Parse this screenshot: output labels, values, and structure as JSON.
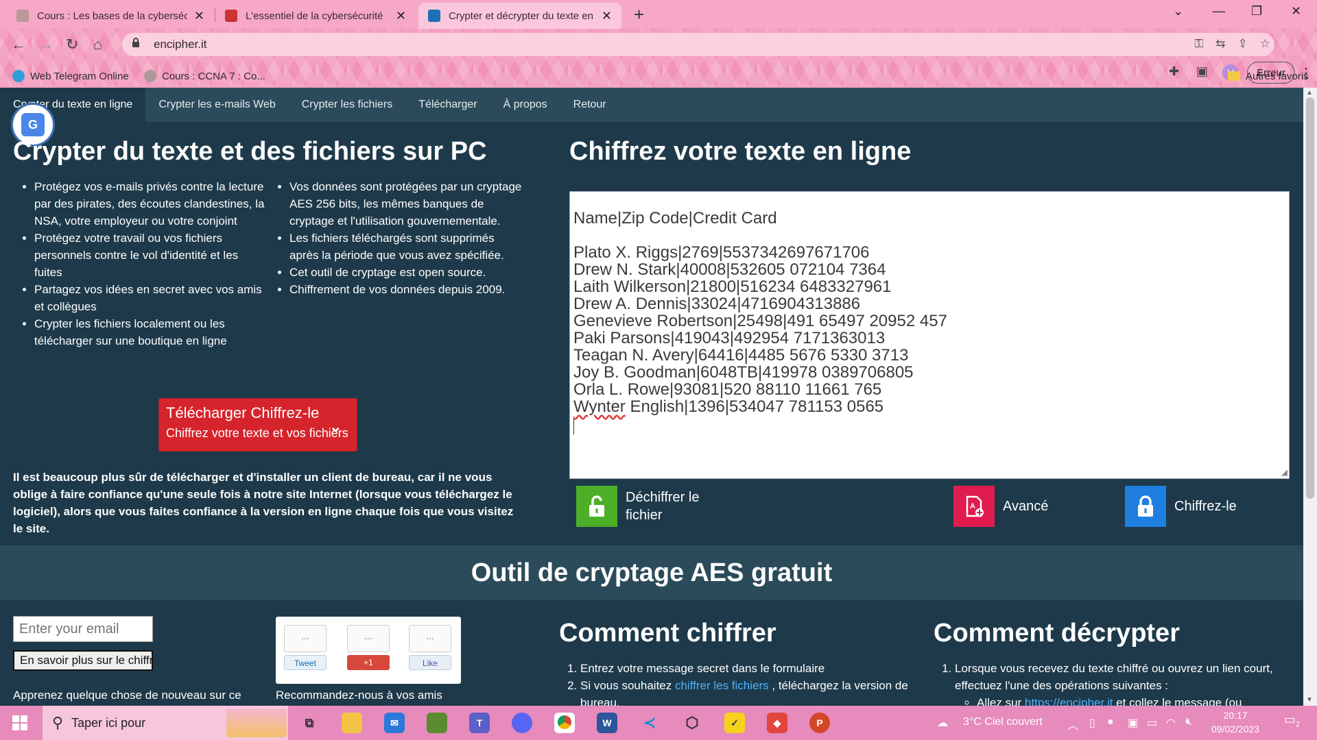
{
  "browser": {
    "tabs": [
      {
        "title": "Cours : Les bases de la cybersécu",
        "active": false
      },
      {
        "title": "L'essentiel de la cybersécurité",
        "active": false
      },
      {
        "title": "Crypter et décrypter du texte en",
        "active": true
      }
    ],
    "url": "encipher.it",
    "profile_initial": "V",
    "error_button": "Erreur",
    "bookmarks": [
      {
        "label": "Web Telegram Online"
      },
      {
        "label": "Cours : CCNA 7 : Co..."
      }
    ],
    "other_bookmarks": "Autres favoris"
  },
  "nav": {
    "items": [
      "Crypter du texte en ligne",
      "Crypter les e-mails Web",
      "Crypter les fichiers",
      "Télécharger",
      "À propos",
      "Retour"
    ]
  },
  "left": {
    "title": "Crypter du texte et des fichiers sur PC",
    "col1": [
      "Protégez vos e-mails privés contre la lecture par des pirates, des écoutes clandestines, la NSA, votre employeur ou votre conjoint",
      "Protégez votre travail ou vos fichiers personnels contre le vol d'identité et les fuites",
      "Partagez vos idées en secret avec vos amis et collègues",
      "Crypter les fichiers localement ou les télécharger sur une boutique en ligne"
    ],
    "col2": [
      "Vos données sont protégées par un cryptage AES 256 bits, les mêmes banques de cryptage et l'utilisation gouvernementale.",
      "Les fichiers téléchargés sont supprimés après la période que vous avez spécifiée.",
      "Cet outil de cryptage est open source.",
      "Chiffrement de vos données depuis 2009."
    ],
    "download_title": "Télécharger Chiffrez-le",
    "download_sub": "Chiffrez votre texte et vos fichiers",
    "warning": "Il est beaucoup plus sûr de télécharger et d'installer un client de bureau, car il ne vous oblige à faire confiance qu'une seule fois à notre site Internet (lorsque vous téléchargez le logiciel), alors que vous faites confiance à la version en ligne chaque fois que vous visitez le site."
  },
  "right": {
    "title": "Chiffrez votre texte en ligne",
    "editor_header": "Name|Zip Code|Credit Card",
    "editor_rows": [
      "Plato X. Riggs|2769|5537342697671706",
      "Drew N. Stark|40008|532605 072104 7364",
      "Laith Wilkerson|21800|516234 6483327961",
      "Drew A. Dennis|33024|4716904313886",
      "Genevieve Robertson|25498|491 65497 20952 457",
      "Paki Parsons|419043|492954 7171363013",
      "Teagan N. Avery|64416|4485 5676 5330 3713",
      "Joy B. Goodman|6048TB|419978 0389706805",
      "Orla L. Rowe|93081|520 88110 11661 765"
    ],
    "editor_last_name": "Wynter",
    "editor_last_rest": " English|1396|534047 781153 0565",
    "decrypt_label": "Déchiffrer le fichier",
    "advanced_label": "Avancé",
    "encrypt_label": "Chiffrez-le"
  },
  "band": {
    "title": "Outil de cryptage AES gratuit"
  },
  "bottom": {
    "email_placeholder": "Enter your email",
    "learn_button": "En savoir plus sur le chiffrement",
    "learn_text": "Apprenez quelque chose de nouveau sur ce",
    "social": {
      "count": "...",
      "tweet": "Tweet",
      "plus": "+1",
      "like": "Like"
    },
    "recommend": "Recommandez-nous à vos amis",
    "how_encrypt": {
      "title": "Comment chiffrer",
      "step1": "Entrez votre message secret dans le formulaire",
      "step2_pre": "Si vous souhaitez ",
      "step2_link": "chiffrer les fichiers",
      "step2_post": " , téléchargez la version de bureau."
    },
    "how_decrypt": {
      "title": "Comment décrypter",
      "step1": "Lorsque vous recevez du texte chiffré ou ouvrez un lien court, effectuez l'une des opérations suivantes :",
      "sub_pre": "Allez sur ",
      "sub_link": "https://encipher.it",
      "sub_post": " et collez le message (ou"
    }
  },
  "taskbar": {
    "search_placeholder": "Taper ici pour",
    "weather": "3°C  Ciel couvert",
    "time": "20:17",
    "date": "09/02/2023",
    "notif_count": "2"
  },
  "colors": {
    "accent_red": "#d6242c",
    "green": "#4caf27",
    "pink": "#e01c4f",
    "blue": "#1f7fe0",
    "page_bg": "#1e3a4a",
    "nav_bg": "#2b4b5a"
  }
}
